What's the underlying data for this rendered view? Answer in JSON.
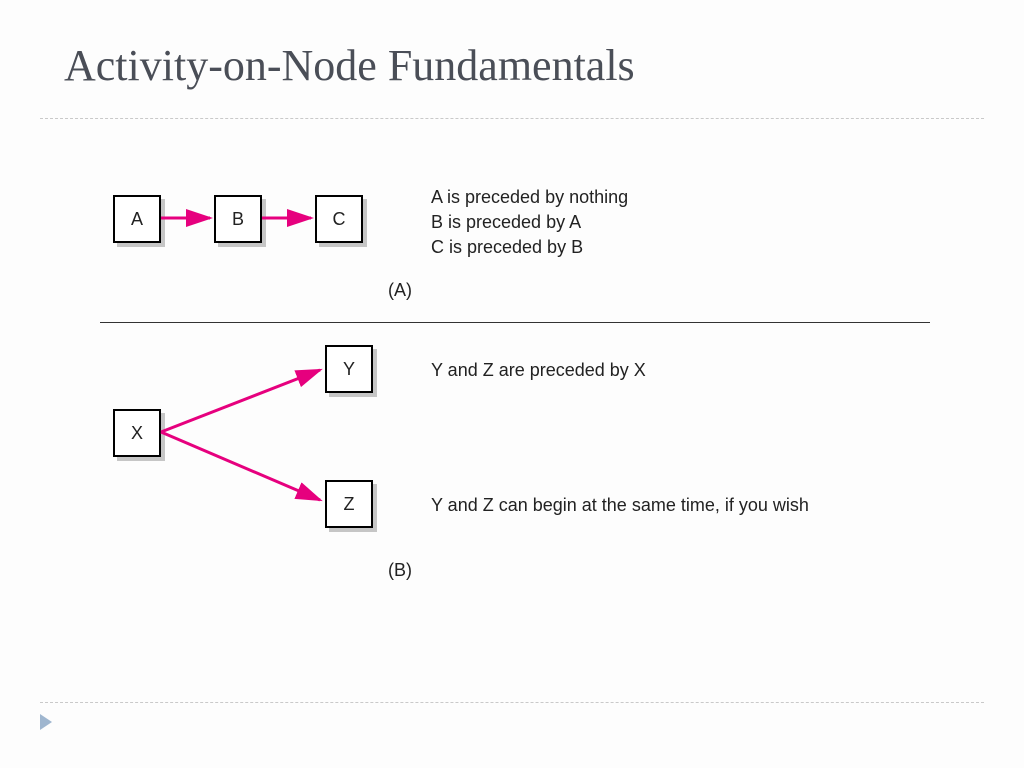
{
  "title": "Activity-on-Node Fundamentals",
  "diagramA": {
    "nodes": {
      "a": "A",
      "b": "B",
      "c": "C"
    },
    "description": "A is preceded by nothing\nB is preceded by A\nC is preceded by B",
    "label": "(A)"
  },
  "diagramB": {
    "nodes": {
      "x": "X",
      "y": "Y",
      "z": "Z"
    },
    "descriptionTop": "Y and Z are preceded by X",
    "descriptionBottom": "Y and Z can begin at the same time, if you wish",
    "label": "(B)"
  },
  "colors": {
    "arrow": "#e6007e"
  }
}
